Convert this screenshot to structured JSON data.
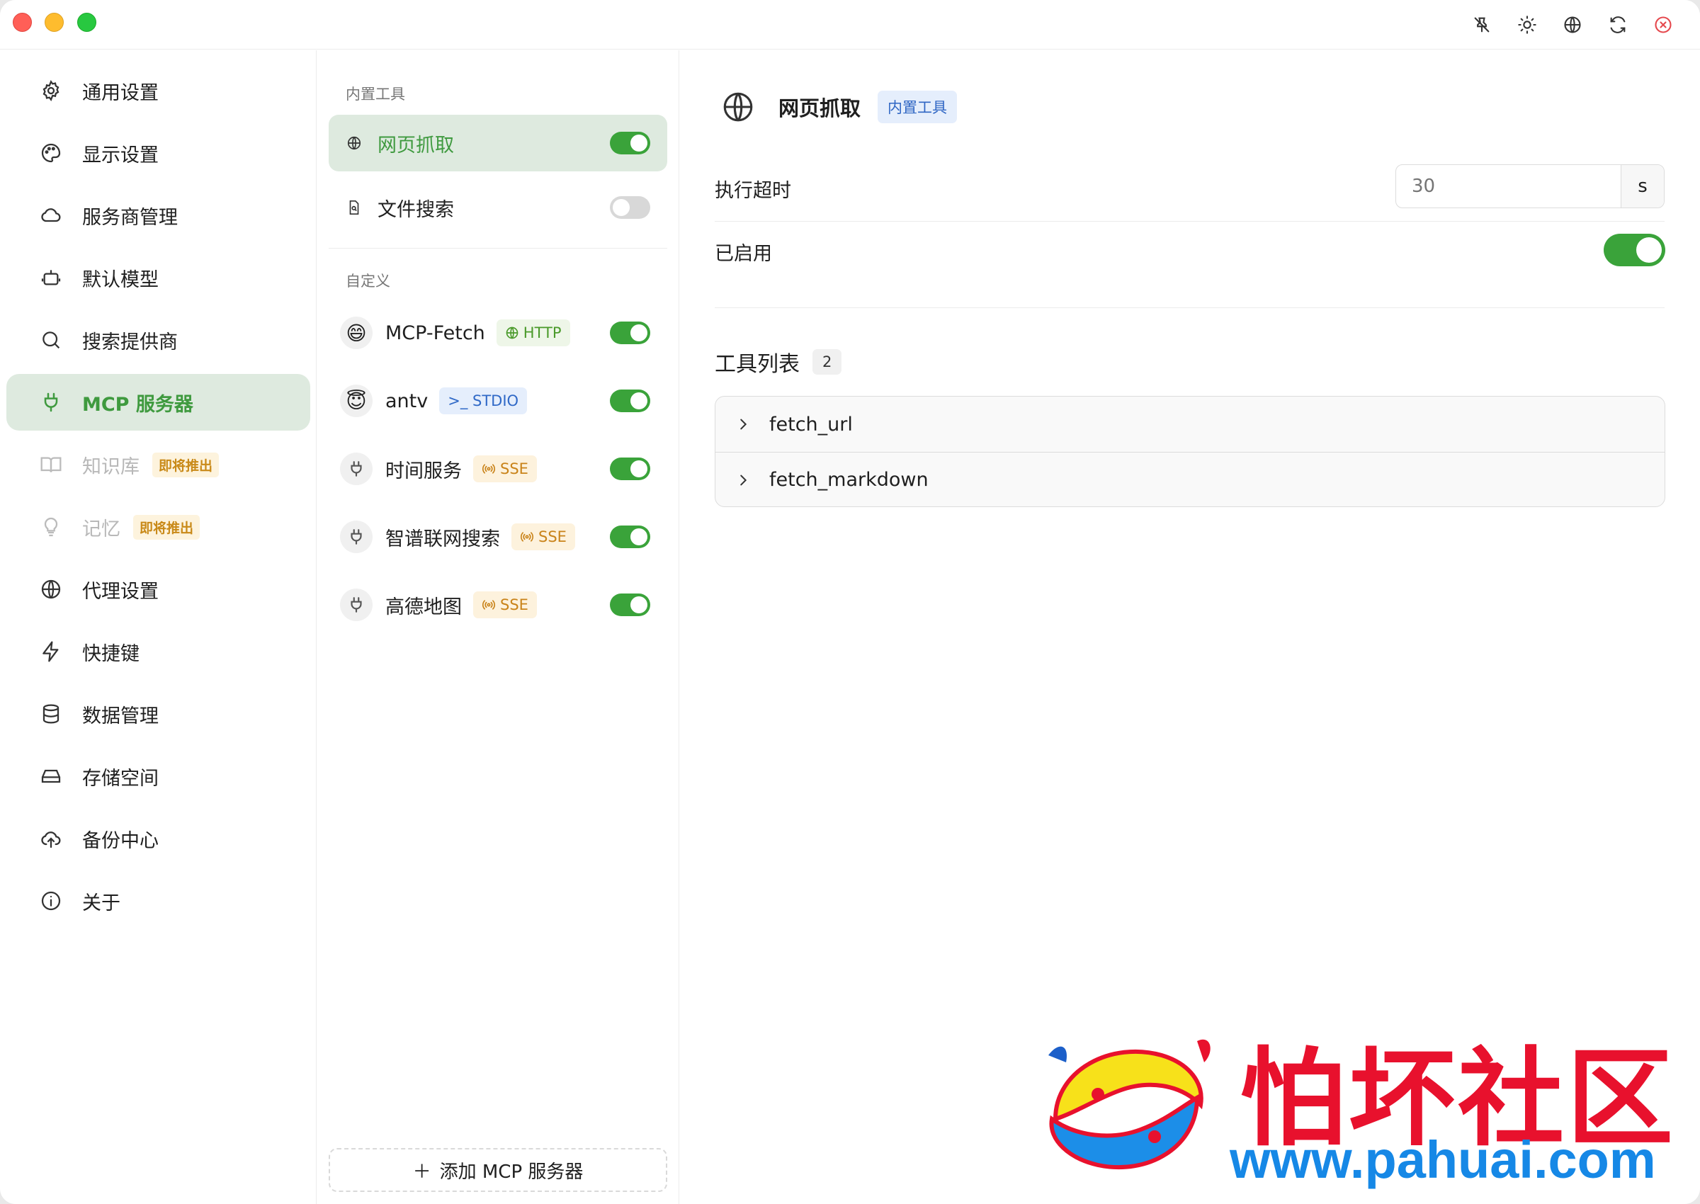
{
  "nav": {
    "items": [
      {
        "label": "通用设置",
        "icon": "gear-icon"
      },
      {
        "label": "显示设置",
        "icon": "palette-icon"
      },
      {
        "label": "服务商管理",
        "icon": "cloud-icon"
      },
      {
        "label": "默认模型",
        "icon": "robot-icon"
      },
      {
        "label": "搜索提供商",
        "icon": "search-icon"
      },
      {
        "label": "MCP 服务器",
        "icon": "plug-icon"
      },
      {
        "label": "知识库",
        "icon": "book-icon",
        "badge": "即将推出"
      },
      {
        "label": "记忆",
        "icon": "bulb-icon",
        "badge": "即将推出"
      },
      {
        "label": "代理设置",
        "icon": "globe-icon"
      },
      {
        "label": "快捷键",
        "icon": "lightning-icon"
      },
      {
        "label": "数据管理",
        "icon": "database-icon"
      },
      {
        "label": "存储空间",
        "icon": "drive-icon"
      },
      {
        "label": "备份中心",
        "icon": "cloud-upload-icon"
      },
      {
        "label": "关于",
        "icon": "info-icon"
      }
    ]
  },
  "servers": {
    "builtin_label": "内置工具",
    "builtin": [
      {
        "name": "网页抓取",
        "icon": "globe-icon",
        "enabled": true
      },
      {
        "name": "文件搜索",
        "icon": "file-search-icon",
        "enabled": false
      }
    ],
    "custom_label": "自定义",
    "custom": [
      {
        "name": "MCP-Fetch",
        "avatar": "😄",
        "tag": "HTTP",
        "enabled": true
      },
      {
        "name": "antv",
        "avatar": "😇",
        "tag": ">_ STDIO",
        "enabled": true
      },
      {
        "name": "时间服务",
        "avatar": "plug-icon",
        "tag": "SSE",
        "enabled": true
      },
      {
        "name": "智谱联网搜索",
        "avatar": "plug-icon",
        "tag": "SSE",
        "enabled": true
      },
      {
        "name": "高德地图",
        "avatar": "plug-icon",
        "tag": "SSE",
        "enabled": true
      }
    ],
    "add_label": "添加 MCP 服务器"
  },
  "detail": {
    "title": "网页抓取",
    "badge": "内置工具",
    "timeout_label": "执行超时",
    "timeout_placeholder": "30",
    "timeout_unit": "s",
    "enabled_label": "已启用",
    "enabled": true,
    "tools_title": "工具列表",
    "tools_count": "2",
    "tools": [
      "fetch_url",
      "fetch_markdown"
    ]
  },
  "watermark": {
    "text": "怕坏社区",
    "url": "www.pahuai.com"
  },
  "colors": {
    "accent": "#3aa33a",
    "active_bg": "#deeadf",
    "soon_badge": "#c98a19",
    "http_tag": "#4a9a2a",
    "stdio_tag": "#3069c7",
    "sse_tag": "#c98319"
  }
}
